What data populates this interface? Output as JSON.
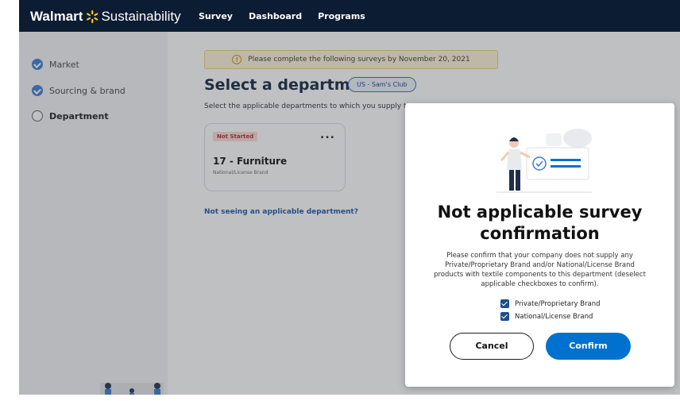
{
  "header": {
    "brand_primary": "Walmart",
    "brand_secondary": "Sustainability",
    "nav": [
      "Survey",
      "Dashboard",
      "Programs"
    ]
  },
  "sidebar": {
    "steps": [
      {
        "label": "Market",
        "state": "complete"
      },
      {
        "label": "Sourcing & brand",
        "state": "complete"
      },
      {
        "label": "Department",
        "state": "current"
      }
    ]
  },
  "main": {
    "banner": "Please complete the following surveys by November 20, 2021",
    "title": "Select a department",
    "pill": "US - Sam's Club",
    "subtitle": "Select the applicable departments to which you supply t",
    "card": {
      "status": "Not Started",
      "more": "...",
      "title": "17 - Furniture",
      "subtitle": "National/License Brand"
    },
    "help_link": "Not seeing an applicable department?"
  },
  "modal": {
    "title": "Not applicable survey confirmation",
    "body": "Please confirm that your company does not supply any Private/Proprietary Brand and/or National/License Brand products with textile components to this department (deselect applicable checkboxes to confirm).",
    "checkboxes": [
      {
        "label": "Private/Proprietary Brand",
        "checked": true
      },
      {
        "label": "National/License Brand",
        "checked": true
      }
    ],
    "cancel_label": "Cancel",
    "confirm_label": "Confirm"
  },
  "colors": {
    "header_bg": "#0c1d33",
    "brand_spark": "#ffc220",
    "primary": "#0071ce",
    "step_complete": "#3a7dd1",
    "badge_bg": "#fbdcd9",
    "badge_text": "#b32b21",
    "banner_bg": "#fef4d8"
  }
}
